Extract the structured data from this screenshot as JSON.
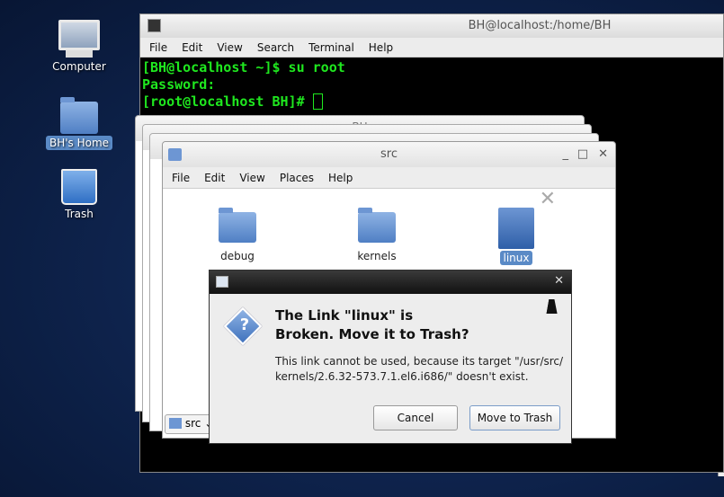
{
  "desktop": {
    "icons": [
      {
        "label": "Computer",
        "icon": "computer-icon"
      },
      {
        "label": "BH's Home",
        "icon": "home-folder-icon",
        "selected": true
      },
      {
        "label": "Trash",
        "icon": "trash-icon"
      }
    ]
  },
  "terminal": {
    "title": "BH@localhost:/home/BH",
    "menu": [
      "File",
      "Edit",
      "View",
      "Search",
      "Terminal",
      "Help"
    ],
    "lines": [
      "[BH@localhost ~]$ su root",
      "Password:",
      "[root@localhost BH]# "
    ],
    "text_color": "#1fe81f"
  },
  "file_window": {
    "title": "src",
    "background_title": "BH",
    "menu": [
      "File",
      "Edit",
      "View",
      "Places",
      "Help"
    ],
    "items": [
      {
        "name": "debug",
        "type": "folder"
      },
      {
        "name": "kernels",
        "type": "folder"
      },
      {
        "name": "linux",
        "type": "broken-link",
        "selected": true
      }
    ],
    "location": "src"
  },
  "dialog": {
    "title_line1": "The Link \"linux\" is",
    "title_line2": "Broken. Move it to Trash?",
    "message_line1": "This link cannot be used, because its target \"/usr/src/",
    "message_line2": "kernels/2.6.32-573.7.1.el6.i686/\" doesn't exist.",
    "cancel": "Cancel",
    "confirm": "Move to Trash"
  }
}
